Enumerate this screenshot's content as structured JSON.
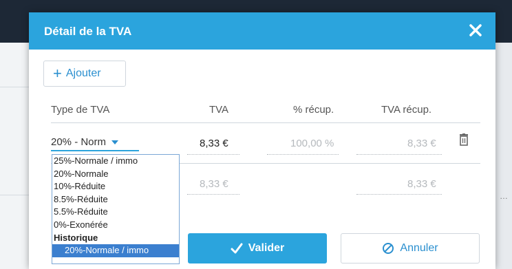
{
  "dialog": {
    "title": "Détail de la TVA",
    "close_icon": "close-icon"
  },
  "toolbar": {
    "add_label": "Ajouter",
    "add_icon": "plus-icon"
  },
  "table": {
    "headers": [
      "Type de TVA",
      "TVA",
      "% récup.",
      "TVA récup."
    ],
    "rows": [
      {
        "type": "20% - Norm",
        "tva": "8,33 €",
        "pct": "100,00 %",
        "tva_recup": "8,33 €"
      },
      {
        "type": "",
        "tva": "8,33 €",
        "pct": "",
        "tva_recup": "8,33 €"
      }
    ]
  },
  "dropdown": {
    "options": [
      "25%-Normale / immo",
      "20%-Normale",
      "10%-Réduite",
      "8.5%-Réduite",
      "5.5%-Réduite",
      "0%-Exonérée"
    ],
    "group_label": "Historique",
    "selected_option": "20%-Normale / immo"
  },
  "footer": {
    "validate_label": "Valider",
    "cancel_label": "Annuler"
  },
  "colors": {
    "accent": "#2ba4dd",
    "link": "#2a8fcf",
    "selected": "#3b7fcf"
  }
}
